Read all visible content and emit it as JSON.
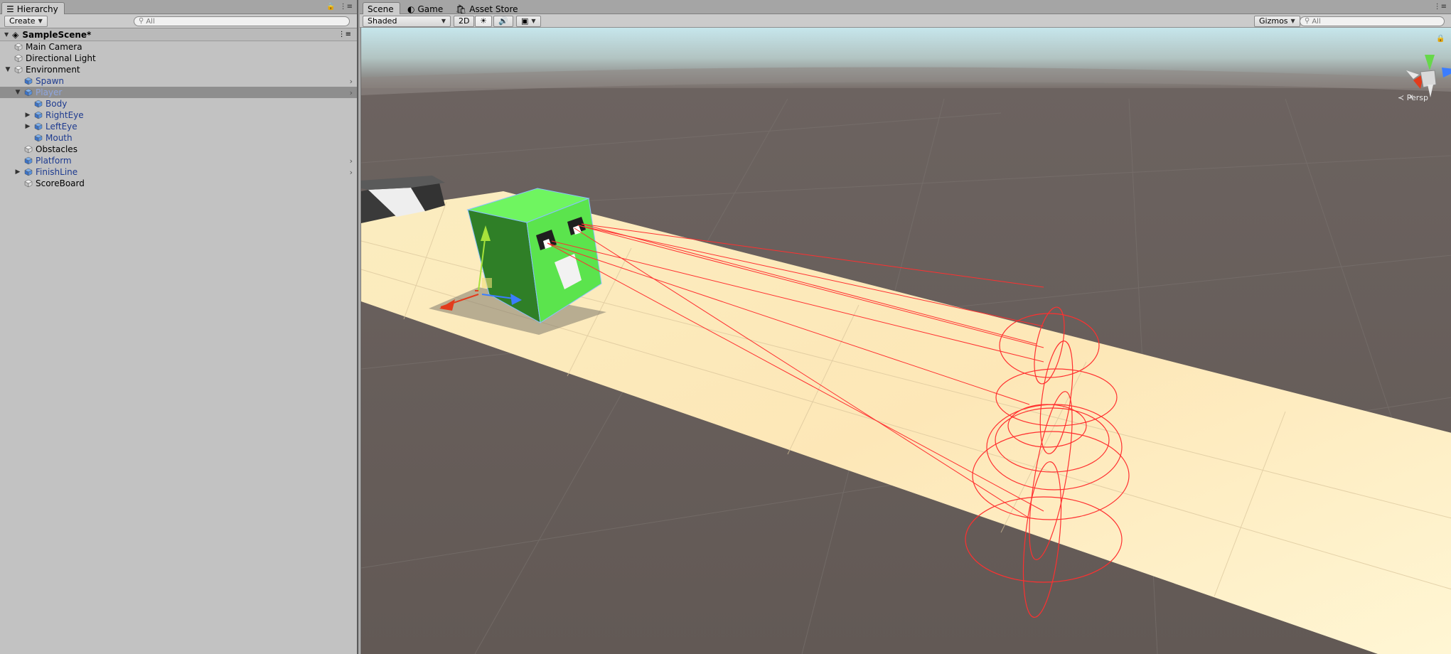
{
  "hierarchy": {
    "tab_label": "Hierarchy",
    "create_label": "Create",
    "search_placeholder": "All",
    "scene_name": "SampleScene*",
    "items": [
      {
        "label": "Main Camera",
        "prefab": false
      },
      {
        "label": "Directional Light",
        "prefab": false
      },
      {
        "label": "Environment",
        "prefab": false
      },
      {
        "label": "Spawn",
        "prefab": true
      },
      {
        "label": "Player",
        "prefab": true
      },
      {
        "label": "Body",
        "prefab": true
      },
      {
        "label": "RightEye",
        "prefab": true
      },
      {
        "label": "LeftEye",
        "prefab": true
      },
      {
        "label": "Mouth",
        "prefab": true
      },
      {
        "label": "Obstacles",
        "prefab": false
      },
      {
        "label": "Platform",
        "prefab": true
      },
      {
        "label": "FinishLine",
        "prefab": true
      },
      {
        "label": "ScoreBoard",
        "prefab": false
      }
    ],
    "selected_item": "Player"
  },
  "scene_view": {
    "tabs": [
      {
        "label": "Scene"
      },
      {
        "label": "Game"
      },
      {
        "label": "Asset Store"
      }
    ],
    "shading_mode": "Shaded",
    "toggle_2d": "2D",
    "gizmos_label": "Gizmos",
    "search_placeholder": "All",
    "projection_label": "Persp",
    "gizmo_axes": {
      "x": "x",
      "z": "z"
    }
  },
  "colors": {
    "panel_bg": "#c2c2c2",
    "selection_bg": "#8e8e8e",
    "prefab_text": "#1d3a8f",
    "sky": "#c9e6ea",
    "ground": "#665d58",
    "platform": "#fcefc4",
    "player_green": "#5bea4a",
    "raycast_red": "#ff2a2a"
  }
}
